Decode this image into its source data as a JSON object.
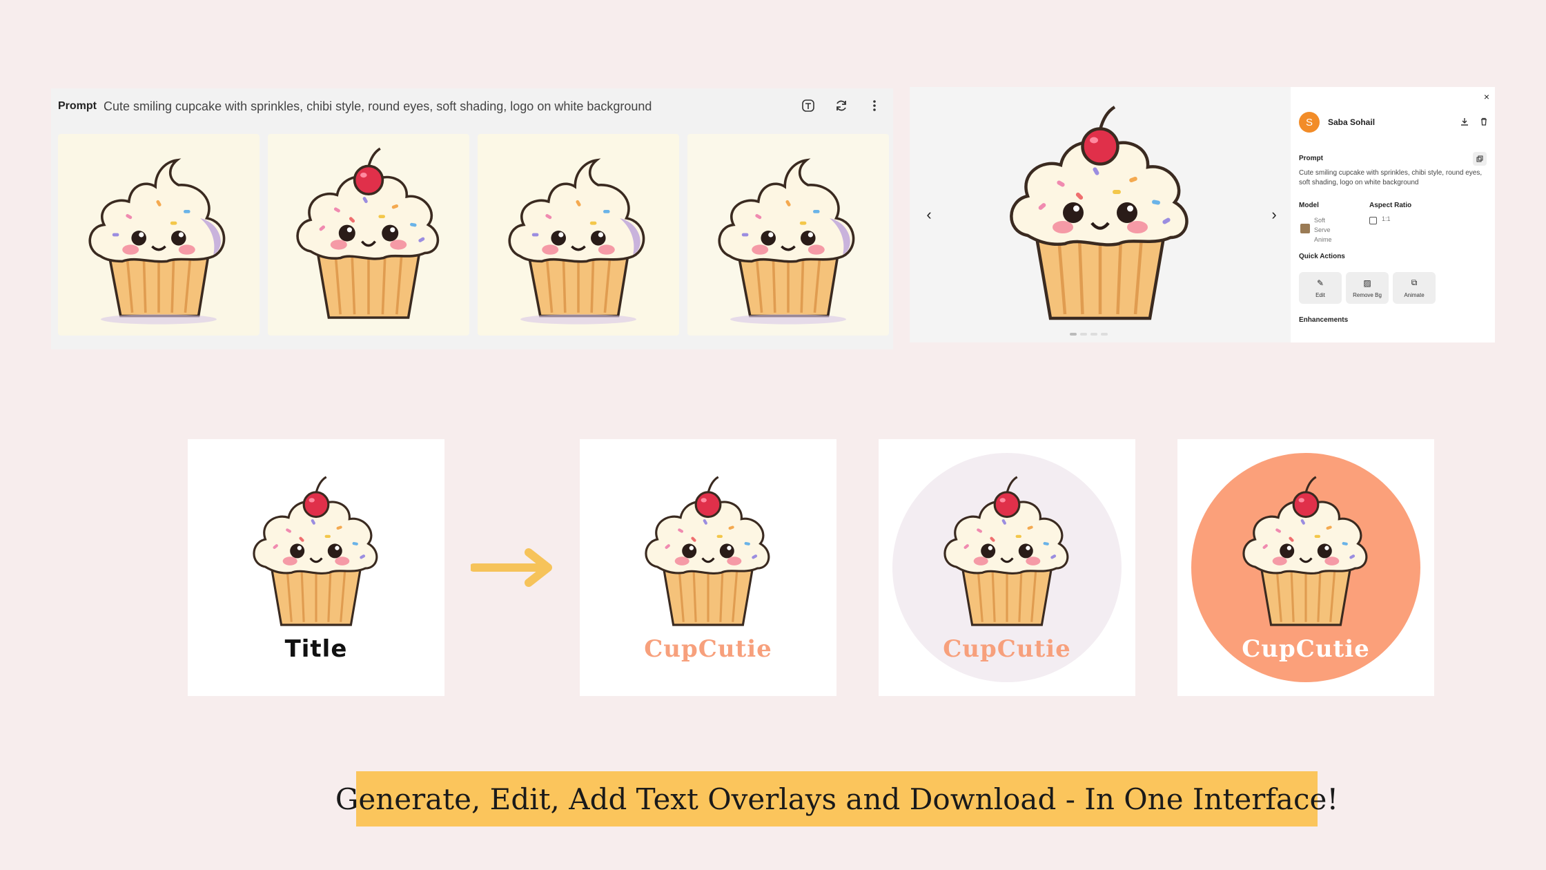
{
  "prompt_panel": {
    "label": "Prompt",
    "text": "Cute smiling cupcake with sprinkles, chibi style, round eyes, soft shading, logo on white background",
    "icons": [
      "text-icon",
      "refresh-icon",
      "more-vertical-icon"
    ]
  },
  "viewer": {
    "prev": "‹",
    "next": "›"
  },
  "details": {
    "close": "×",
    "user": {
      "initial": "S",
      "name": "Saba Sohail"
    },
    "prompt_label": "Prompt",
    "prompt_text": "Cute smiling cupcake with sprinkles, chibi style, round eyes, soft shading, logo on white background",
    "model_label": "Model",
    "model_value": "Soft Serve Anime",
    "aspect_label": "Aspect Ratio",
    "aspect_value": "1:1",
    "quick_actions_label": "Quick Actions",
    "quick_actions": [
      "Edit",
      "Remove Bg",
      "Animate"
    ],
    "enhancements_label": "Enhancements"
  },
  "cards": {
    "title_placeholder": "Title",
    "brand": "CupCutie"
  },
  "colors": {
    "accent_orange": "#fba07a",
    "lavender": "#f3edf2",
    "arrow": "#f6c35a",
    "banner": "#fbc55c"
  },
  "banner": {
    "text": "Generate, Edit, Add Text Overlays and Download - In One Interface!"
  }
}
